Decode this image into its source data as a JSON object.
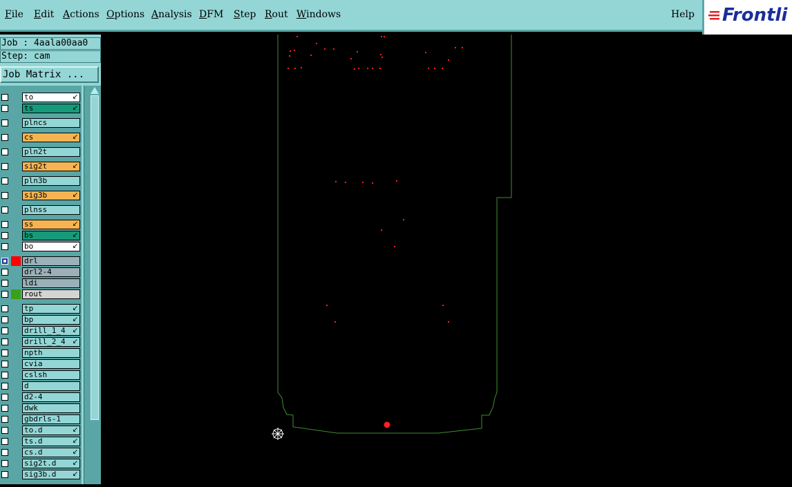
{
  "menu": {
    "items": [
      "File",
      "Edit",
      "Actions",
      "Options",
      "Analysis",
      "DFM",
      "Step",
      "Rout",
      "Windows"
    ],
    "help": "Help"
  },
  "logo": {
    "text": "Frontli"
  },
  "job": {
    "label": "Job : 4aala00aa0"
  },
  "step": {
    "label": "Step: cam"
  },
  "job_matrix_button": "Job Matrix ...",
  "layers": [
    {
      "name": "to",
      "color": "#ffffff",
      "arrow": true,
      "swatch": null
    },
    {
      "name": "ts",
      "color": "#179a7a",
      "arrow": true,
      "swatch": null
    },
    {
      "name": "plncs",
      "color": "#94d6d6",
      "arrow": false,
      "swatch": null
    },
    {
      "name": "cs",
      "color": "#f5b451",
      "arrow": true,
      "swatch": null
    },
    {
      "name": "pln2t",
      "color": "#94d6d6",
      "arrow": false,
      "swatch": null
    },
    {
      "name": "sig2t",
      "color": "#f5b451",
      "arrow": true,
      "swatch": null
    },
    {
      "name": "pln3b",
      "color": "#94d6d6",
      "arrow": false,
      "swatch": null
    },
    {
      "name": "sig3b",
      "color": "#f5b451",
      "arrow": true,
      "swatch": null
    },
    {
      "name": "plnss",
      "color": "#94d6d6",
      "arrow": false,
      "swatch": null
    },
    {
      "name": "ss",
      "color": "#f5b451",
      "arrow": true,
      "swatch": null
    },
    {
      "name": "bs",
      "color": "#179a7a",
      "arrow": true,
      "swatch": null
    },
    {
      "name": "bo",
      "color": "#ffffff",
      "arrow": true,
      "swatch": null
    },
    {
      "name": "drl",
      "color": "#9bb0b8",
      "arrow": false,
      "swatch": "#ff0000",
      "selected": true
    },
    {
      "name": "drl2-4",
      "color": "#9bb0b8",
      "arrow": false,
      "swatch": null
    },
    {
      "name": "ldi",
      "color": "#9bb0b8",
      "arrow": false,
      "swatch": null
    },
    {
      "name": "rout",
      "color": "#d4d4d4",
      "arrow": false,
      "swatch": "#3aa018"
    },
    {
      "name": "tp",
      "color": "#94d6d6",
      "arrow": true,
      "swatch": null
    },
    {
      "name": "bp",
      "color": "#94d6d6",
      "arrow": true,
      "swatch": null
    },
    {
      "name": "drill_1_4",
      "color": "#94d6d6",
      "arrow": true,
      "swatch": null
    },
    {
      "name": "drill_2_4",
      "color": "#94d6d6",
      "arrow": true,
      "swatch": null
    },
    {
      "name": "npth",
      "color": "#94d6d6",
      "arrow": false,
      "swatch": null
    },
    {
      "name": "cvia",
      "color": "#94d6d6",
      "arrow": false,
      "swatch": null
    },
    {
      "name": "cslsh",
      "color": "#94d6d6",
      "arrow": false,
      "swatch": null
    },
    {
      "name": "d",
      "color": "#94d6d6",
      "arrow": false,
      "swatch": null
    },
    {
      "name": "d2-4",
      "color": "#94d6d6",
      "arrow": false,
      "swatch": null
    },
    {
      "name": "dwk",
      "color": "#94d6d6",
      "arrow": false,
      "swatch": null
    },
    {
      "name": "gbdrls-1",
      "color": "#94d6d6",
      "arrow": false,
      "swatch": null
    },
    {
      "name": "to.d",
      "color": "#94d6d6",
      "arrow": true,
      "swatch": null
    },
    {
      "name": "ts.d",
      "color": "#94d6d6",
      "arrow": true,
      "swatch": null
    },
    {
      "name": "cs.d",
      "color": "#94d6d6",
      "arrow": true,
      "swatch": null
    },
    {
      "name": "sig2t.d",
      "color": "#94d6d6",
      "arrow": true,
      "swatch": null
    },
    {
      "name": "sig3b.d",
      "color": "#94d6d6",
      "arrow": true,
      "swatch": null
    }
  ],
  "colors": {
    "outline": "#3f8f2f",
    "drill": "#ff2020",
    "panel": "#94d6d6"
  }
}
